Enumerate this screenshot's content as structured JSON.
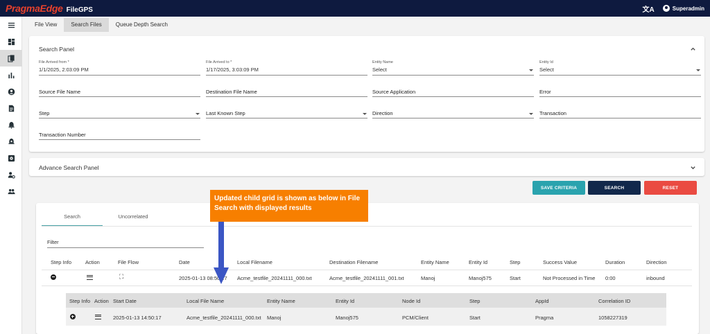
{
  "app": {
    "logo": "PragmaEdge",
    "product": "FileGPS",
    "user": "Superadmin"
  },
  "sidebar": {
    "icons": [
      "menu-icon",
      "dashboard-icon",
      "files-icon",
      "bar-chart-icon",
      "user-circle-icon",
      "document-icon",
      "alert-icon",
      "alert-settings-icon",
      "settings-box-icon",
      "user-gear-icon",
      "group-icon"
    ],
    "active_index": 2
  },
  "tabs": [
    {
      "label": "File View"
    },
    {
      "label": "Search Files"
    },
    {
      "label": "Queue Depth Search"
    }
  ],
  "search_panel": {
    "title": "Search Panel",
    "file_arrived_from": {
      "label": "File Arrived from *",
      "value": "1/1/2025, 2:03:09 PM"
    },
    "file_arrived_to": {
      "label": "File Arrived to *",
      "value": "1/17/2025, 3:03:09 PM"
    },
    "entity_name": {
      "label": "Entity Name",
      "value": "Select"
    },
    "entity_id": {
      "label": "Entity Id",
      "value": "Select"
    },
    "source_file_name": "Source File Name",
    "destination_file_name": "Destination File Name",
    "source_application": "Source Application",
    "error": "Error",
    "step": "Step",
    "last_known_step": "Last Known Step",
    "direction": "Direction",
    "transaction": "Transaction",
    "transaction_number": "Transaction Number"
  },
  "advance_panel": {
    "title": "Advance Search Panel"
  },
  "buttons": {
    "save_criteria": {
      "label": "SAVE CRITERIA",
      "color": "#2aa3ae"
    },
    "search": {
      "label": "SEARCH",
      "color": "#12284b"
    },
    "reset": {
      "label": "RESET",
      "color": "#ea4b42"
    }
  },
  "callout": {
    "text": "Updated child grid is shown as below in File Search with displayed results",
    "color": "#f77f00",
    "arrow_color": "#3b56c4"
  },
  "results": {
    "tabs": [
      "Search",
      "Uncorrelated"
    ],
    "filter_placeholder": "Filter",
    "columns": [
      "Step Info",
      "Action",
      "File Flow",
      "Date",
      "Local Filename",
      "Destination Filename",
      "Entity Name",
      "Entity Id",
      "Step",
      "Success Value",
      "Duration",
      "Direction"
    ],
    "row": {
      "date": "2025-01-13 08:50:17",
      "local_filename": "Acme_testfile_20241111_000.txt",
      "destination_filename": "Acme_testfile_20241111_001.txt",
      "entity_name": "Manoj",
      "entity_id": "Manoj575",
      "step": "Start",
      "success_value": "Not Processed in Time",
      "duration": "0:00",
      "direction": "inbound"
    },
    "child": {
      "columns": [
        "Step Info",
        "Action",
        "Start Date",
        "Local File Name",
        "Entity Name",
        "Entity Id",
        "Node Id",
        "Step",
        "AppId",
        "Correlation ID"
      ],
      "row": {
        "start_date": "2025-01-13 14:50:17",
        "local_file_name": "Acme_testfile_20241111_000.txt",
        "entity_name": "Manoj",
        "entity_id": "Manoj575",
        "node_id": "PCM/Client",
        "step": "Start",
        "app_id": "Pragma",
        "correlation_id": "1058227319"
      }
    }
  }
}
